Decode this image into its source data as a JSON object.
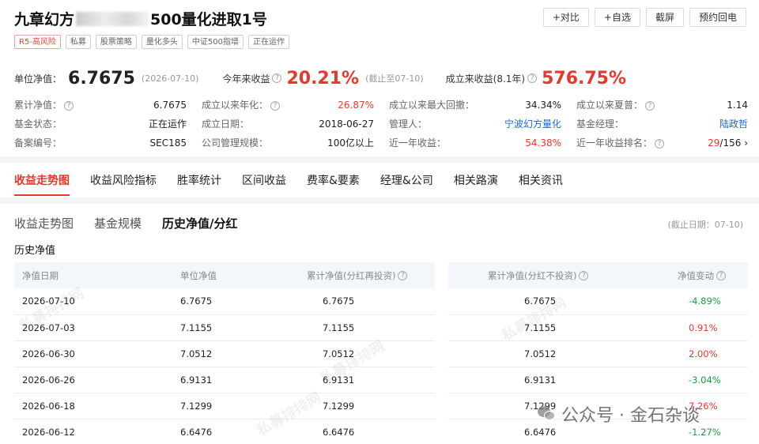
{
  "fund": {
    "name_part1": "九章幻方",
    "name_part2": "500量化进取1号",
    "tags": [
      "R5-高风险",
      "私募",
      "股票策略",
      "量化多头",
      "中证500指增",
      "正在运作"
    ]
  },
  "actions": [
    "+对比",
    "+自选",
    "截屏",
    "预约回电"
  ],
  "summary": {
    "nav_label": "单位净值：",
    "nav_value": "6.7675",
    "nav_date": "(2026-07-10)",
    "ytd_label": "今年来收益",
    "ytd_value": "20.21%",
    "ytd_note": "(截止至07-10)",
    "inception_label": "成立来收益(8.1年)",
    "inception_value": "576.75%"
  },
  "stats": [
    {
      "label": "累计净值：",
      "value": "6.7675",
      "help": true,
      "style": ""
    },
    {
      "label": "成立以来年化：",
      "value": "26.87%",
      "help": true,
      "style": "red"
    },
    {
      "label": "成立以来最大回撤：",
      "value": "34.34%",
      "help": false,
      "style": ""
    },
    {
      "label": "成立以来夏普：",
      "value": "1.14",
      "help": true,
      "style": ""
    },
    {
      "label": "基金状态：",
      "value": "正在运作",
      "help": false,
      "style": ""
    },
    {
      "label": "成立日期：",
      "value": "2018-06-27",
      "help": false,
      "style": ""
    },
    {
      "label": "管理人：",
      "value": "宁波幻方量化",
      "help": false,
      "style": "blue"
    },
    {
      "label": "基金经理：",
      "value": "陆政哲",
      "help": false,
      "style": "blue"
    },
    {
      "label": "备案编号：",
      "value": "SEC185",
      "help": false,
      "style": ""
    },
    {
      "label": "公司管理规模：",
      "value": "100亿以上",
      "help": false,
      "style": ""
    },
    {
      "label": "近一年收益：",
      "value": "54.38%",
      "help": false,
      "style": "red"
    },
    {
      "label": "近一年收益排名：",
      "value_rank": "29",
      "value_total": "/156",
      "help": true,
      "style": "rank"
    }
  ],
  "tabs": [
    "收益走势图",
    "收益风险指标",
    "胜率统计",
    "区间收益",
    "费率&要素",
    "经理&公司",
    "相关路演",
    "相关资讯"
  ],
  "subtabs": [
    "收益走势图",
    "基金规模",
    "历史净值/分红"
  ],
  "cutoff": "(截止日期：07-10)",
  "section_title": "历史净值",
  "table_left": {
    "headers": [
      "净值日期",
      "单位净值",
      "累计净值(分红再投资)"
    ],
    "rows": [
      [
        "2026-07-10",
        "6.7675",
        "6.7675"
      ],
      [
        "2026-07-03",
        "7.1155",
        "7.1155"
      ],
      [
        "2026-06-30",
        "7.0512",
        "7.0512"
      ],
      [
        "2026-06-26",
        "6.9131",
        "6.9131"
      ],
      [
        "2026-06-18",
        "7.1299",
        "7.1299"
      ],
      [
        "2026-06-12",
        "6.6476",
        "6.6476"
      ]
    ]
  },
  "table_right": {
    "headers": [
      "累计净值(分红不投资)",
      "净值变动"
    ],
    "rows": [
      [
        "6.7675",
        "-4.89%",
        "green"
      ],
      [
        "7.1155",
        "0.91%",
        "red"
      ],
      [
        "7.0512",
        "2.00%",
        "red"
      ],
      [
        "6.9131",
        "-3.04%",
        "green"
      ],
      [
        "7.1299",
        "7.26%",
        "red"
      ],
      [
        "6.6476",
        "-1.27%",
        "green"
      ]
    ]
  },
  "watermark_text": "私募排排网",
  "wechat_label": "公众号 · 金石杂谈",
  "colors": {
    "accent_red": "#e8382c",
    "positive_green": "#1a9e3a",
    "link_blue": "#1a66d6"
  }
}
